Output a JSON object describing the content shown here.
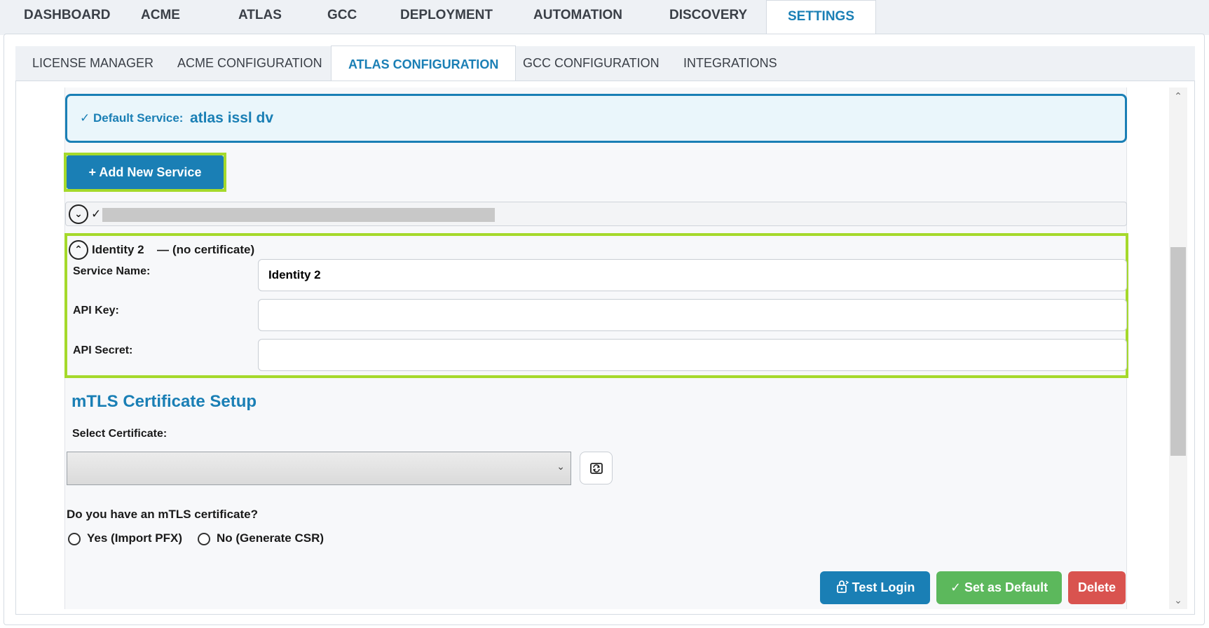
{
  "top_tabs": [
    "DASHBOARD",
    "ACME",
    "ATLAS",
    "GCC",
    "DEPLOYMENT",
    "AUTOMATION",
    "DISCOVERY",
    "SETTINGS"
  ],
  "sub_tabs": [
    "LICENSE MANAGER",
    "ACME CONFIGURATION",
    "ATLAS CONFIGURATION",
    "GCC CONFIGURATION",
    "INTEGRATIONS"
  ],
  "default_service": {
    "label": "✓ Default Service:",
    "value": "atlas issl dv"
  },
  "add_service_button": "+ Add New Service",
  "collapsed_service": {
    "check": "✓"
  },
  "identity": {
    "header": "Identity 2",
    "dash": "—",
    "cert_status": "(no certificate)",
    "service_name_label": "Service Name:",
    "service_name_value": "Identity 2",
    "api_key_label": "API Key:",
    "api_key_value": "",
    "api_secret_label": "API Secret:",
    "api_secret_value": ""
  },
  "mtls": {
    "title": "mTLS Certificate Setup",
    "select_label": "Select Certificate:",
    "selected_value": "",
    "question": "Do you have an mTLS certificate?",
    "option_yes": "Yes (Import PFX)",
    "option_no": "No (Generate CSR)"
  },
  "actions": {
    "test_login": "Test Login",
    "set_default": "✓ Set as Default",
    "delete": "Delete"
  },
  "colors": {
    "accent": "#1a7fb5",
    "highlight": "#a5d92b",
    "success": "#5cb85c",
    "danger": "#d9534f"
  }
}
